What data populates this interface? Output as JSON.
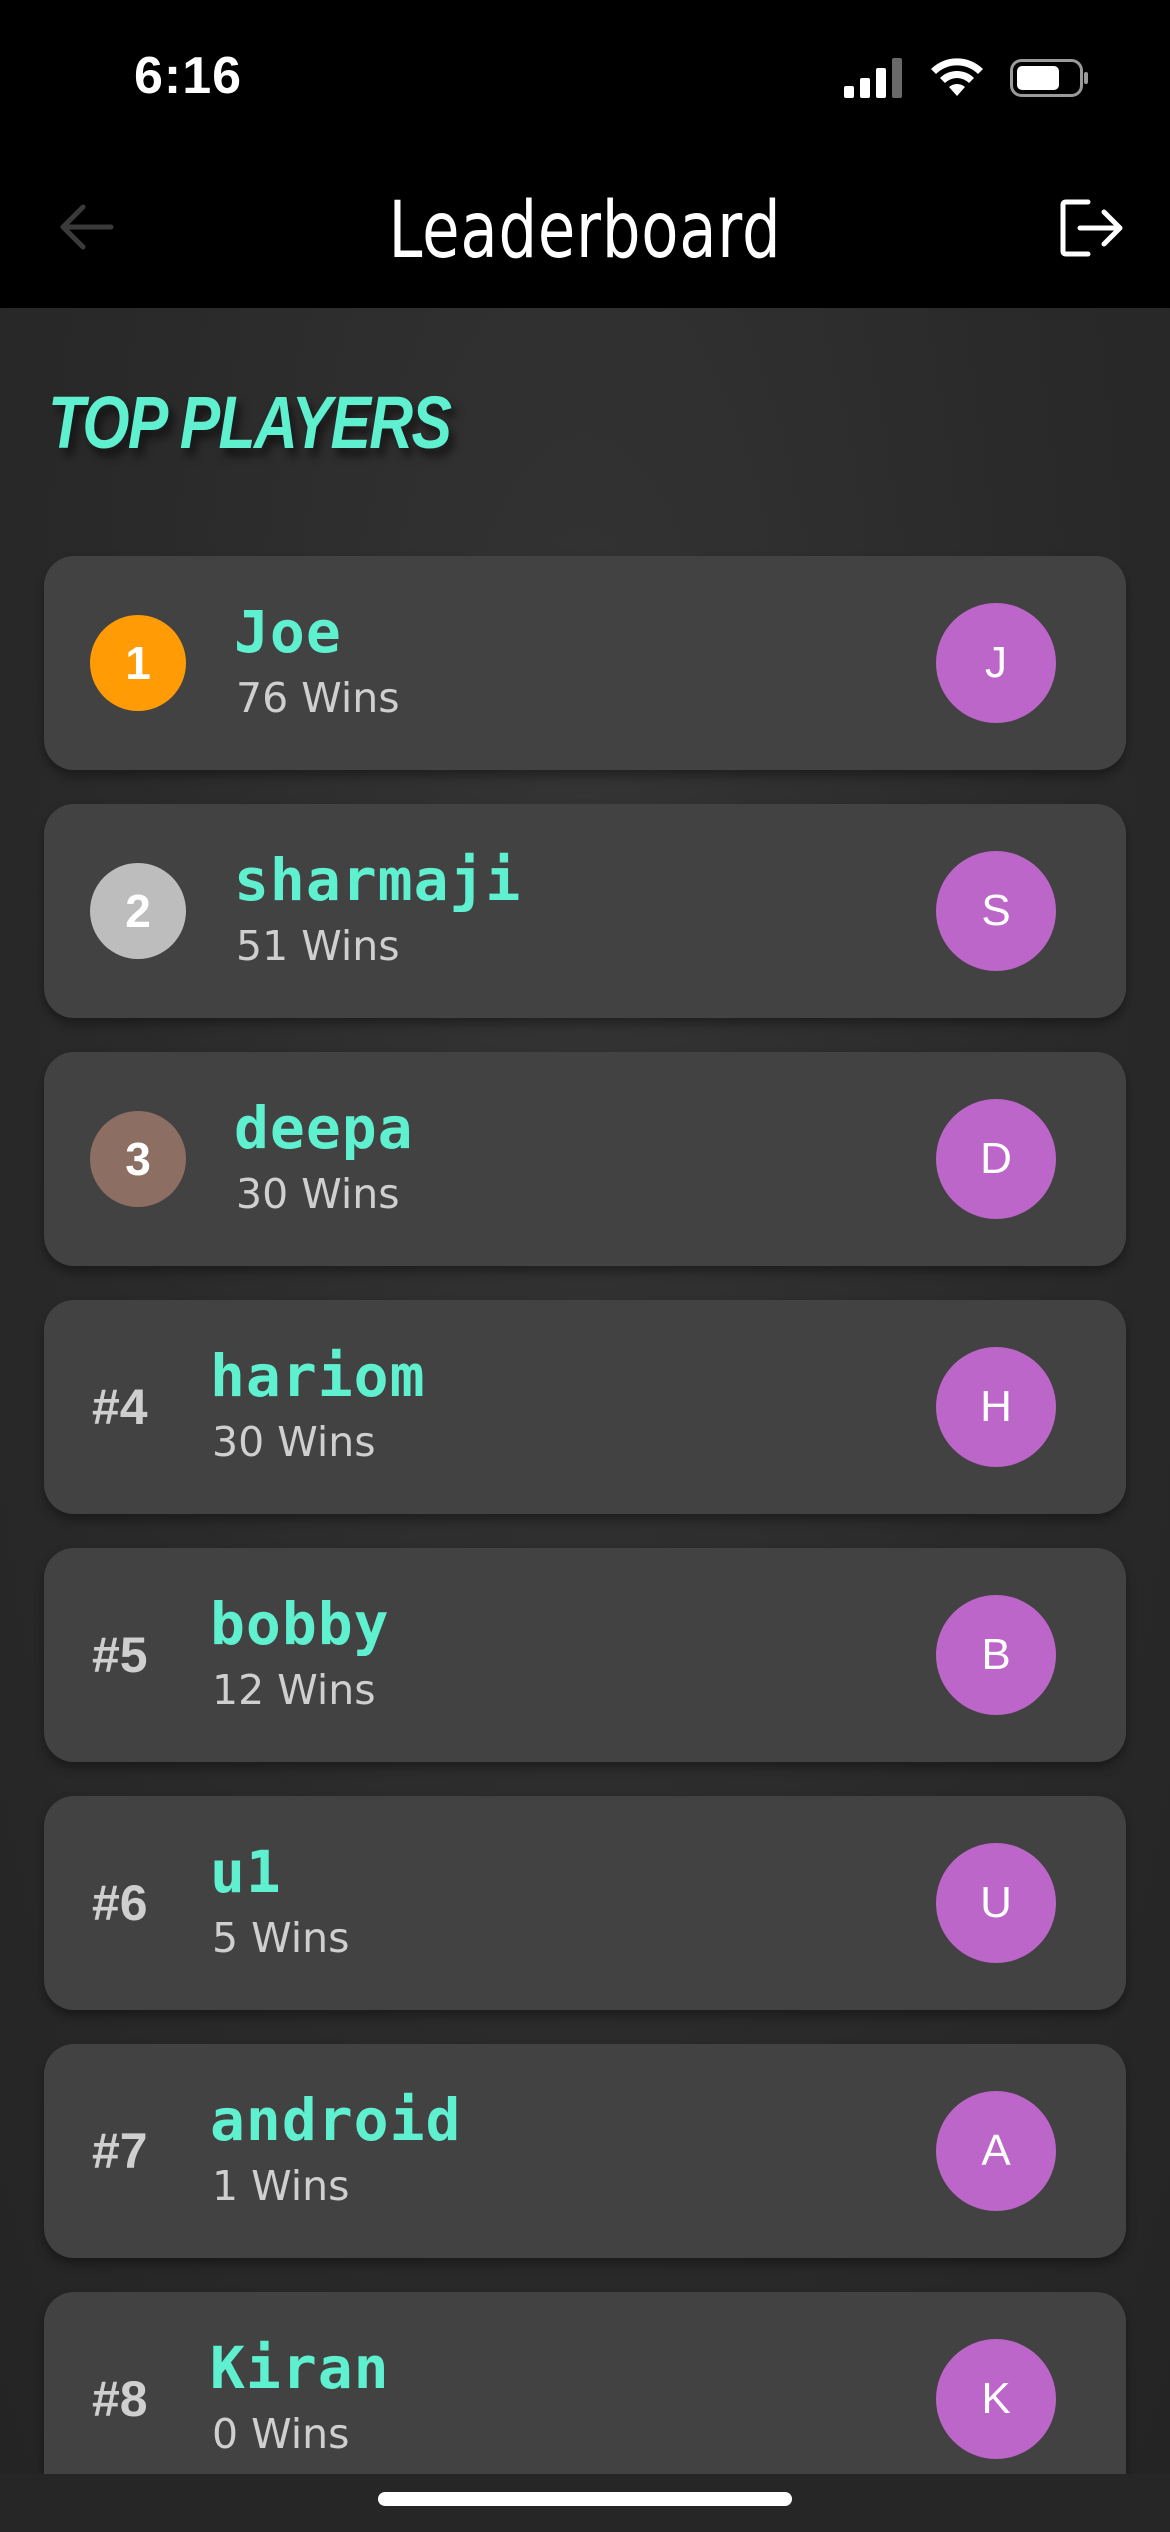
{
  "status_bar": {
    "time": "6:16",
    "icons": [
      "signal-icon",
      "wifi-icon",
      "battery-icon"
    ]
  },
  "nav": {
    "title": "Leaderboard",
    "back_icon": "back-arrow-icon",
    "logout_icon": "logout-icon"
  },
  "section_title": "TOP PLAYERS",
  "players": [
    {
      "rank": "1",
      "name": "Joe",
      "wins": "76 Wins",
      "initial": "J",
      "medal_color": "#ff9b05"
    },
    {
      "rank": "2",
      "name": "sharmaji",
      "wins": "51 Wins",
      "initial": "S",
      "medal_color": "#bdbdbd"
    },
    {
      "rank": "3",
      "name": "deepa",
      "wins": "30 Wins",
      "initial": "D",
      "medal_color": "#8d6e63"
    },
    {
      "rank": "#4",
      "name": "hariom",
      "wins": "30 Wins",
      "initial": "H"
    },
    {
      "rank": "#5",
      "name": "bobby",
      "wins": "12 Wins",
      "initial": "B"
    },
    {
      "rank": "#6",
      "name": "u1",
      "wins": "5 Wins",
      "initial": "U"
    },
    {
      "rank": "#7",
      "name": "android",
      "wins": "1 Wins",
      "initial": "A"
    },
    {
      "rank": "#8",
      "name": "Kiran",
      "wins": "0 Wins",
      "initial": "K"
    }
  ],
  "colors": {
    "accent": "#5ff0cf",
    "avatar": "#bb66c8",
    "card": "#424242"
  }
}
